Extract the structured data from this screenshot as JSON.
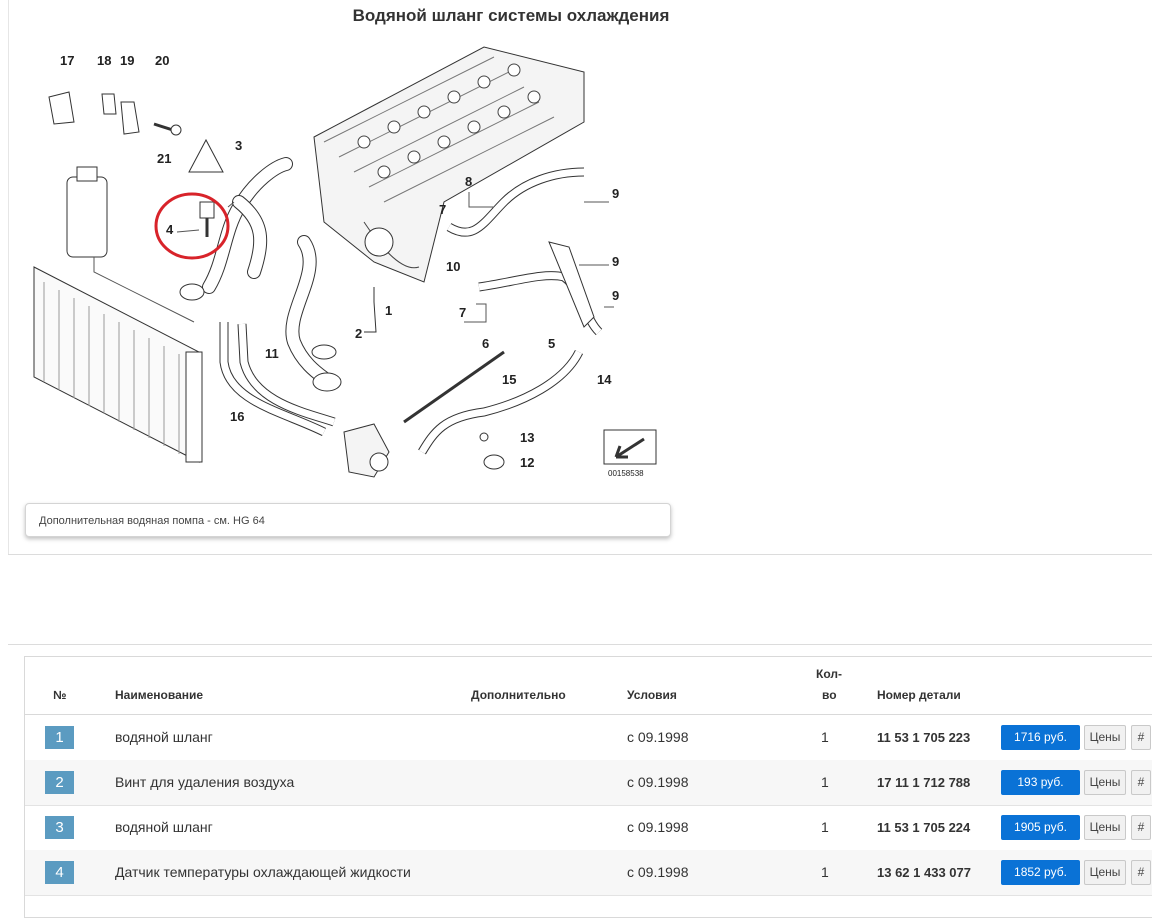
{
  "page": {
    "title": "Водяной шланг системы охлаждения"
  },
  "diagram": {
    "code": "00158538",
    "callouts": [
      "17",
      "18",
      "19",
      "20",
      "21",
      "3",
      "4",
      "8",
      "7",
      "9",
      "10",
      "9",
      "9",
      "1",
      "2",
      "11",
      "16",
      "6",
      "5",
      "15",
      "14",
      "13",
      "12",
      "7"
    ]
  },
  "note": {
    "text": "Дополнительная водяная помпа - см. HG 64"
  },
  "table": {
    "headers": {
      "num": "№",
      "name": "Наименование",
      "extra": "Дополнительно",
      "cond": "Условия",
      "qty_line1": "Кол-",
      "qty_line2": "во",
      "part": "Номер детали"
    },
    "rows": [
      {
        "num": "1",
        "name": "водяной шланг",
        "cond": "с 09.1998",
        "qty": "1",
        "part": "11 53 1 705 223",
        "price": "1716 руб.",
        "prices": "Цены",
        "hash": "#"
      },
      {
        "num": "2",
        "name": "Винт для удаления воздуха",
        "cond": "с 09.1998",
        "qty": "1",
        "part": "17 11 1 712 788",
        "price": "193 руб.",
        "prices": "Цены",
        "hash": "#"
      },
      {
        "num": "3",
        "name": "водяной шланг",
        "cond": "с 09.1998",
        "qty": "1",
        "part": "11 53 1 705 224",
        "price": "1905 руб.",
        "prices": "Цены",
        "hash": "#"
      },
      {
        "num": "4",
        "name": "Датчик температуры охлаждающей жидкости",
        "cond": "с 09.1998",
        "qty": "1",
        "part": "13 62 1 433 077",
        "price": "1852 руб.",
        "prices": "Цены",
        "hash": "#"
      }
    ]
  },
  "colors": {
    "accent": "#0a72d6",
    "badge": "#5b9bc1",
    "highlight": "#d8232a"
  }
}
